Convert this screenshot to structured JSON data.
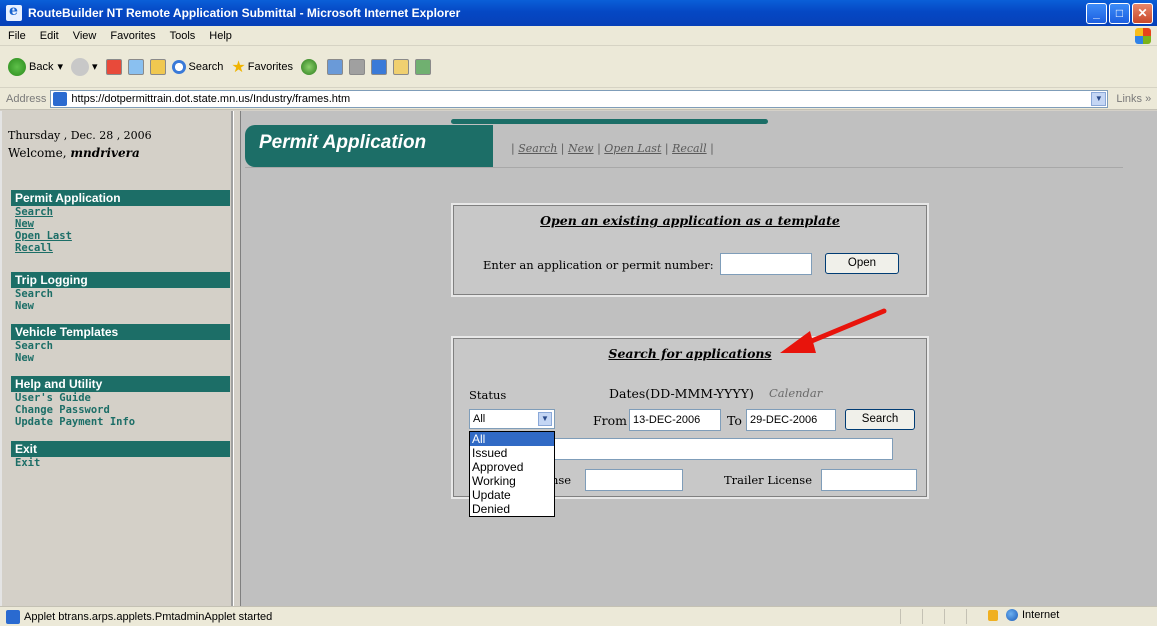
{
  "window": {
    "title": "RouteBuilder NT Remote Application Submittal - Microsoft Internet Explorer"
  },
  "menu": [
    "File",
    "Edit",
    "View",
    "Favorites",
    "Tools",
    "Help"
  ],
  "toolbar": {
    "back": "Back",
    "search": "Search",
    "favorites": "Favorites"
  },
  "address": {
    "label": "Address",
    "url": "https://dotpermittrain.dot.state.mn.us/Industry/frames.htm",
    "links": "Links"
  },
  "sidebar": {
    "date": "Thursday , Dec. 28 , 2006",
    "welcome_prefix": "Welcome, ",
    "username": "mndrivera",
    "sections": [
      {
        "title": "Permit Application",
        "links": [
          "Search",
          "New",
          "Open Last",
          "Recall"
        ]
      },
      {
        "title": "Trip Logging",
        "links": [
          "Search",
          "New"
        ]
      },
      {
        "title": "Vehicle Templates",
        "links": [
          "Search",
          "New"
        ]
      },
      {
        "title": "Help and Utility",
        "links": [
          "User's Guide",
          "Change Password",
          "Update Payment Info"
        ]
      },
      {
        "title": "Exit",
        "links": [
          "Exit"
        ]
      }
    ]
  },
  "header": {
    "title": "Permit Application",
    "links": [
      "Search",
      "New",
      "Open Last",
      "Recall"
    ]
  },
  "open_panel": {
    "heading": "Open an existing application as a template",
    "label": "Enter an application or permit number:",
    "value": "",
    "button": "Open"
  },
  "search_panel": {
    "heading": "Search for applications",
    "status_label": "Status",
    "dates_label": "Dates(DD-MMM-YYYY)",
    "calendar_link": "Calendar",
    "status_value": "All",
    "from_label": "From",
    "from_value": "13-DEC-2006",
    "to_label": "To",
    "to_value": "29-DEC-2006",
    "search_button": "Search",
    "power_license_label_left": "P",
    "power_license_label_right": "nse",
    "trailer_license_label": "Trailer License",
    "status_options": [
      "All",
      "Issued",
      "Approved",
      "Working",
      "Update",
      "Denied"
    ]
  },
  "statusbar": {
    "text": "Applet btrans.arps.applets.PmtadminApplet started",
    "zone": "Internet"
  },
  "colors": {
    "accent": "#1c6e67",
    "arrow": "#e8140c"
  }
}
